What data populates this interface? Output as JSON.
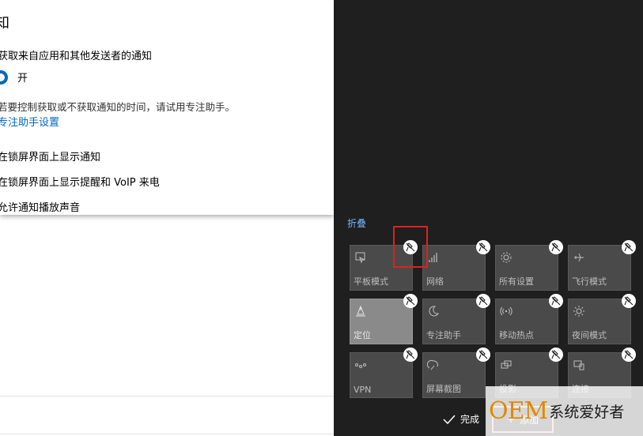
{
  "settings": {
    "heading": "知",
    "notify_from_apps": "获取来自应用和其他发送者的通知",
    "toggle_label": "开",
    "focus_desc": "若要控制获取或不获取通知的时间，请试用专注助手。",
    "focus_link": "专注助手设置",
    "lock_screen_notify": "在锁屏界面上显示通知",
    "lock_screen_voip": "在锁屏界面上显示提醒和 VoIP 来电",
    "notify_sound": "允许通知播放声音"
  },
  "action_center": {
    "collapse_label": "折叠",
    "tiles": [
      {
        "label": "平板模式",
        "icon": "tablet-mode-icon"
      },
      {
        "label": "网络",
        "icon": "network-icon"
      },
      {
        "label": "所有设置",
        "icon": "settings-gear-icon"
      },
      {
        "label": "飞行模式",
        "icon": "airplane-icon"
      },
      {
        "label": "定位",
        "icon": "location-icon"
      },
      {
        "label": "专注助手",
        "icon": "moon-icon"
      },
      {
        "label": "移动热点",
        "icon": "hotspot-icon"
      },
      {
        "label": "夜间模式",
        "icon": "brightness-icon"
      },
      {
        "label": "VPN",
        "icon": "vpn-icon"
      },
      {
        "label": "屏幕截图",
        "icon": "snip-icon"
      },
      {
        "label": "投影",
        "icon": "project-icon"
      },
      {
        "label": "连接",
        "icon": "connect-icon"
      }
    ],
    "done_label": "完成",
    "add_label": "添加"
  },
  "watermark": {
    "oem": "OEM",
    "text": "系统爱好者"
  }
}
